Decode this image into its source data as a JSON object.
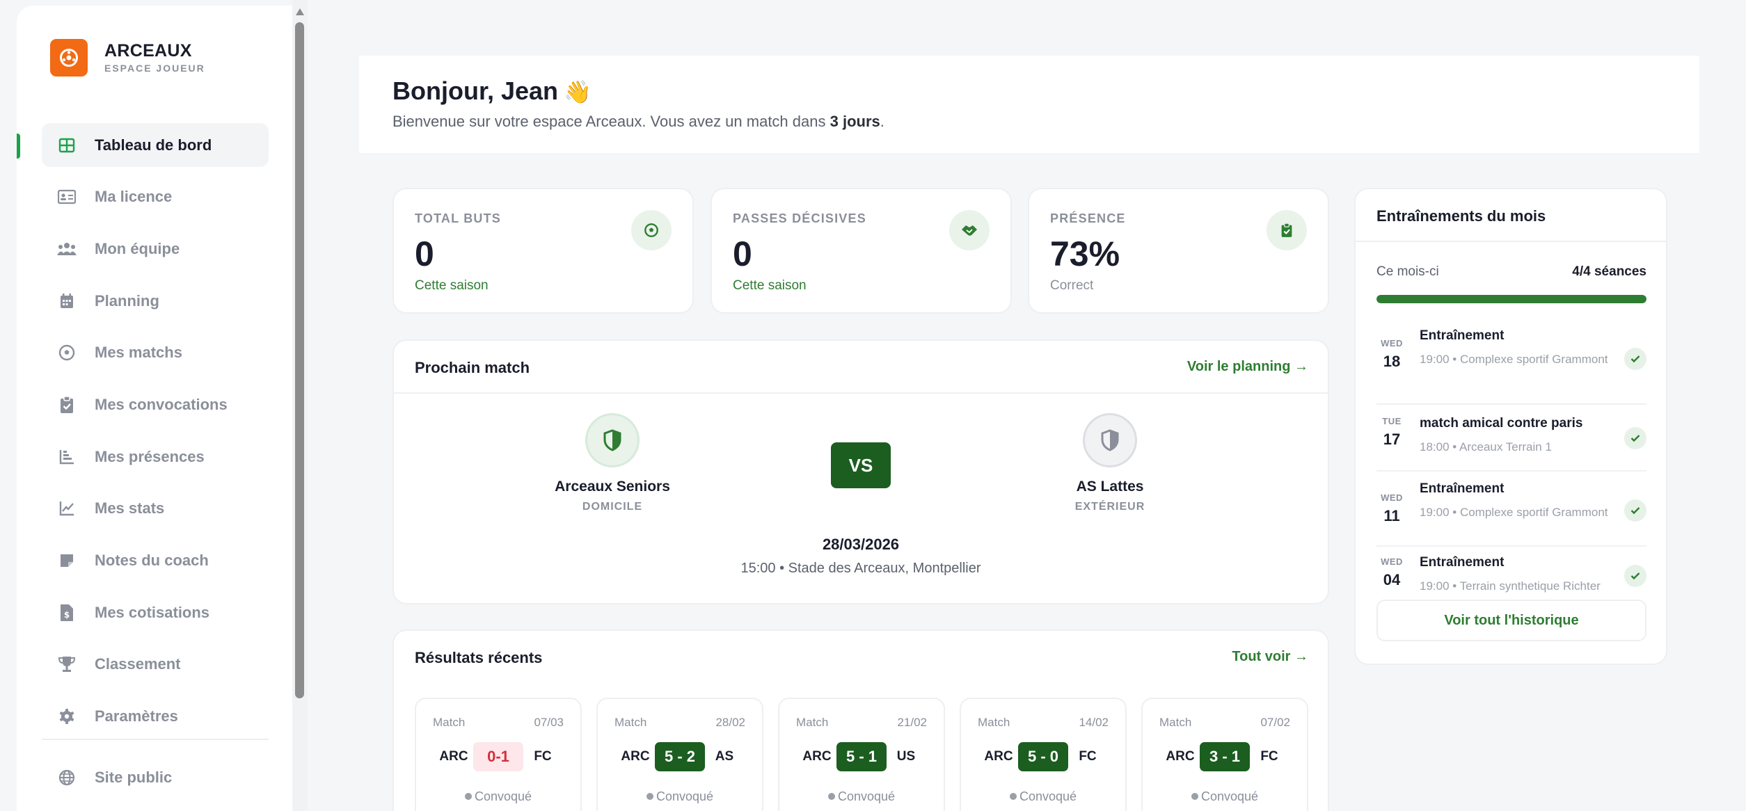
{
  "brand": {
    "name": "ARCEAUX",
    "subtitle": "ESPACE JOUEUR"
  },
  "sidebar": {
    "items": [
      {
        "label": "Tableau de bord",
        "icon": "dashboard-icon",
        "active": true
      },
      {
        "label": "Ma licence",
        "icon": "id-card-icon"
      },
      {
        "label": "Mon équipe",
        "icon": "team-icon"
      },
      {
        "label": "Planning",
        "icon": "calendar-icon"
      },
      {
        "label": "Mes matchs",
        "icon": "soccer-ball-icon"
      },
      {
        "label": "Mes convocations",
        "icon": "clipboard-icon"
      },
      {
        "label": "Mes présences",
        "icon": "bar-chart-icon"
      },
      {
        "label": "Mes stats",
        "icon": "line-chart-icon"
      },
      {
        "label": "Notes du coach",
        "icon": "note-icon"
      },
      {
        "label": "Mes cotisations",
        "icon": "invoice-icon"
      },
      {
        "label": "Classement",
        "icon": "trophy-icon"
      },
      {
        "label": "Paramètres",
        "icon": "gear-icon"
      }
    ],
    "site_public": "Site public"
  },
  "header": {
    "greeting": "Bonjour, Jean",
    "welcome_prefix": "Bienvenue sur votre espace Arceaux. Vous avez un match dans ",
    "welcome_days": "3 jours",
    "welcome_suffix": "."
  },
  "stats": [
    {
      "label": "TOTAL BUTS",
      "value": "0",
      "sub": "Cette saison",
      "icon": "soccer-ball-icon"
    },
    {
      "label": "PASSES DÉCISIVES",
      "value": "0",
      "sub": "Cette saison",
      "icon": "handshake-icon"
    },
    {
      "label": "PRÉSENCE",
      "value": "73%",
      "sub": "Correct",
      "icon": "clipboard-check-icon"
    }
  ],
  "next_match": {
    "title": "Prochain match",
    "link": "Voir le planning →",
    "home": {
      "name": "Arceaux Seniors",
      "side": "DOMICILE"
    },
    "away": {
      "name": "AS Lattes",
      "side": "EXTÉRIEUR"
    },
    "vs": "VS",
    "date": "28/03/2026",
    "info": "15:00 • Stade des Arceaux, Montpellier"
  },
  "results": {
    "title": "Résultats récents",
    "link": "Tout voir →",
    "items": [
      {
        "type": "Match",
        "date": "07/03",
        "home": "ARC",
        "score": "0-1",
        "away": "FC",
        "status": "Convoqué",
        "outcome": "loss"
      },
      {
        "type": "Match",
        "date": "28/02",
        "home": "ARC",
        "score": "5 - 2",
        "away": "AS",
        "status": "Convoqué",
        "outcome": "win"
      },
      {
        "type": "Match",
        "date": "21/02",
        "home": "ARC",
        "score": "5 - 1",
        "away": "US",
        "status": "Convoqué",
        "outcome": "win"
      },
      {
        "type": "Match",
        "date": "14/02",
        "home": "ARC",
        "score": "5 - 0",
        "away": "FC",
        "status": "Convoqué",
        "outcome": "win"
      },
      {
        "type": "Match",
        "date": "07/02",
        "home": "ARC",
        "score": "3 - 1",
        "away": "FC",
        "status": "Convoqué",
        "outcome": "win"
      }
    ]
  },
  "trainings": {
    "title": "Entraînements du mois",
    "progress_label": "Ce mois-ci",
    "progress_value": "4/4 séances",
    "progress_fraction": 1.0,
    "items": [
      {
        "dow": "WED",
        "day": "18",
        "title": "Entraînement",
        "meta": "19:00 • Complexe sportif Grammont"
      },
      {
        "dow": "TUE",
        "day": "17",
        "title": "match amical contre paris",
        "meta": "18:00 • Arceaux Terrain 1"
      },
      {
        "dow": "WED",
        "day": "11",
        "title": "Entraînement",
        "meta": "19:00 • Complexe sportif Grammont"
      },
      {
        "dow": "WED",
        "day": "04",
        "title": "Entraînement",
        "meta": "19:00 • Terrain synthetique Richter"
      }
    ],
    "history_button": "Voir tout l'historique"
  },
  "colors": {
    "accent": "#2e7d32",
    "dark_green": "#1b5e20",
    "brand_orange": "#f26a14",
    "loss_red": "#d32f3a"
  }
}
